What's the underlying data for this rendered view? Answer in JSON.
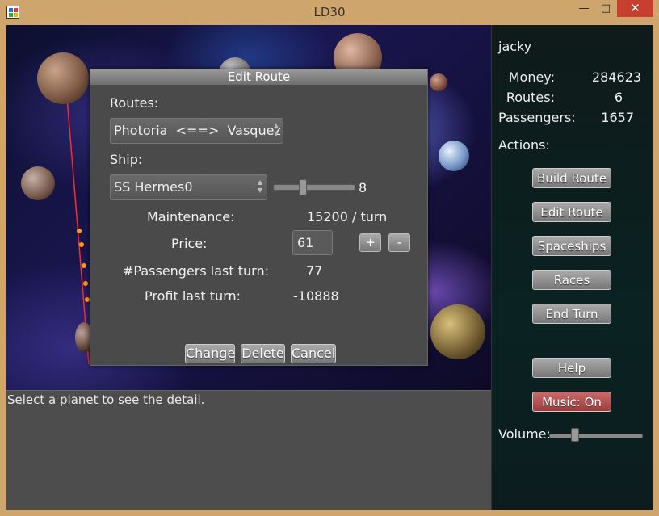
{
  "window": {
    "title": "LD30",
    "minimize_glyph": "—",
    "maximize_glyph": "□",
    "close_glyph": "✕"
  },
  "info_panel": {
    "text": "Select a planet to see the detail."
  },
  "sidebar": {
    "player_name": "jacky",
    "stats": [
      {
        "label": "Money:",
        "value": "284623"
      },
      {
        "label": "Routes:",
        "value": "6"
      },
      {
        "label": "Passengers:",
        "value": "1657"
      }
    ],
    "actions_label": "Actions:",
    "buttons": {
      "build_route": "Build Route",
      "edit_route": "Edit Route",
      "spaceships": "Spaceships",
      "races": "Races",
      "end_turn": "End Turn",
      "help": "Help",
      "music": "Music: On"
    },
    "volume_label": "Volume:",
    "volume_level": 0.27
  },
  "dialog": {
    "title": "Edit Route",
    "routes_label": "Routes:",
    "route_value": "Photoria  <==>  Vasquez",
    "ship_label": "Ship:",
    "ship_value": "SS Hermes0",
    "ship_slider_value": "8",
    "maintenance_label": "Maintenance:",
    "maintenance_value": "15200 / turn",
    "price_label": "Price:",
    "price_value": "61",
    "plus_label": "+",
    "minus_label": "-",
    "passengers_label": "#Passengers last turn:",
    "passengers_value": "77",
    "profit_label": "Profit last turn:",
    "profit_value": "-10888",
    "change_label": "Change",
    "delete_label": "Delete",
    "cancel_label": "Cancel"
  },
  "colors": {
    "music_button": "#a13a3a",
    "dialog_bg": "#4a4a4a",
    "info_panel_bg": "#4d4d4d",
    "close_button": "#c7402f"
  }
}
